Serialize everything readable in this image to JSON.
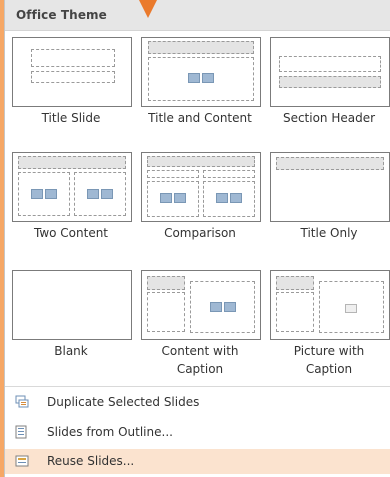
{
  "header": {
    "title": "Office Theme"
  },
  "layouts": [
    {
      "label": "Title Slide"
    },
    {
      "label": "Title and Content"
    },
    {
      "label": "Section Header"
    },
    {
      "label": "Two Content"
    },
    {
      "label": "Comparison"
    },
    {
      "label": "Title Only"
    },
    {
      "label": "Blank"
    },
    {
      "label_line1": "Content with",
      "label_line2": "Caption"
    },
    {
      "label_line1": "Picture with",
      "label_line2": "Caption"
    }
  ],
  "menu": [
    {
      "label": "Duplicate Selected Slides",
      "icon": "duplicate-slides-icon"
    },
    {
      "label": "Slides from Outline...",
      "icon": "outline-icon"
    },
    {
      "label": "Reuse Slides...",
      "icon": "reuse-slides-icon"
    }
  ],
  "colors": {
    "accent": "#ea7a2c",
    "highlight": "#fbe3cf",
    "background": "#f6a765"
  }
}
